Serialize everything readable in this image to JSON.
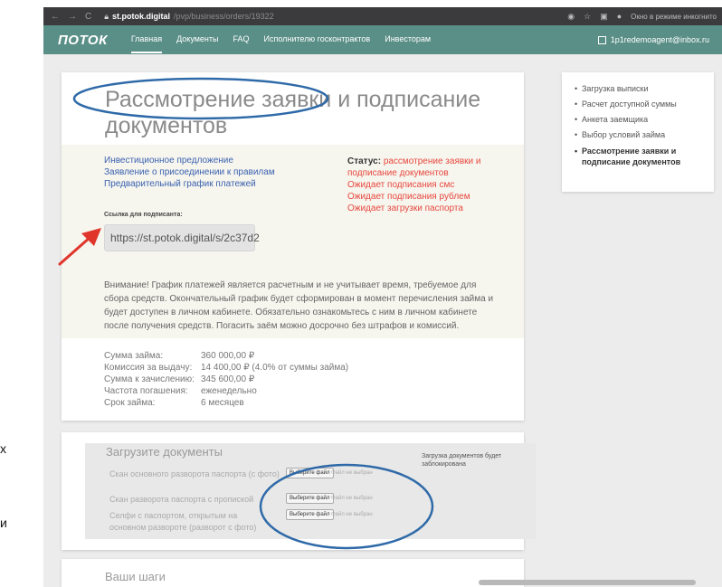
{
  "edge": {
    "char1": "х",
    "char2": "и"
  },
  "browser": {
    "nav_back": "←",
    "nav_forward": "→",
    "nav_reload": "C",
    "url_host": "st.potok.digital",
    "url_path": "/pvp/business/orders/19322",
    "incognito": "Окно в режиме инкогнито"
  },
  "appbar": {
    "logo": "ПОТОК",
    "menu": [
      "Главная",
      "Документы",
      "FAQ",
      "Исполнителю госконтрактов",
      "Инвесторам"
    ],
    "user": "1p1redemoagent@inbox.ru"
  },
  "main": {
    "title": "Рассмотрение заявки и подписание документов",
    "links": [
      "Инвестиционное предложение",
      "Заявление о присоединении к правилам",
      "Предварительный график платежей"
    ],
    "status_label": "Статус:",
    "status_lines": [
      "рассмотрение заявки и",
      "подписание документов",
      "Ожидает подписания смс",
      "Ожидает подписания рублем",
      "Ожидает загрузки паспорта"
    ],
    "sig_label": "Ссылка для подписанта:",
    "sig_link": "https://st.potok.digital/s/2c37d2",
    "notice": "Внимание! График платежей является расчетным и не учитывает время, требуемое для сбора средств. Окончательный график будет сформирован в момент перечисления займа и будет доступен в личном кабинете. Обязательно ознакомьтесь с ним в личном кабинете после получения средств. Погасить заём можно досрочно без штрафов и комиссий.",
    "summary": [
      {
        "k": "Сумма займа:",
        "v": "360 000,00 ₽"
      },
      {
        "k": "Комиссия за выдачу:",
        "v": "14 400,00 ₽ (4.0% от суммы займа)"
      },
      {
        "k": "Сумма к зачислению:",
        "v": "345 600,00 ₽"
      },
      {
        "k": "Частота погашения:",
        "v": "еженедельно"
      },
      {
        "k": "Срок займа:",
        "v": "6 месяцев"
      }
    ]
  },
  "upload": {
    "title": "Загрузите документы",
    "rows": [
      {
        "label": "Скан основного разворота паспорта (с фото)",
        "btn": "Выберите файл",
        "nofile": "Файл не выбран"
      },
      {
        "label": "Скан разворота паспорта с пропиской",
        "btn": "Выберите файл",
        "nofile": "Файл не выбран"
      },
      {
        "label": "Селфи с паспортом, открытым на основном развороте (разворот с фото)",
        "btn": "Выберите файл",
        "nofile": "Файл не выбран"
      }
    ],
    "note": "Загрузка документов будет заблокирована"
  },
  "steps": {
    "title": "Ваши шаги"
  },
  "sidebar": {
    "items": [
      "Загрузка выписки",
      "Расчет доступной суммы",
      "Анкета заемщика",
      "Выбор условий займа",
      "Рассмотрение заявки и подписание документов"
    ]
  },
  "annotation_colors": {
    "ellipse": "#2f6aa8",
    "arrow": "#e0352b"
  }
}
